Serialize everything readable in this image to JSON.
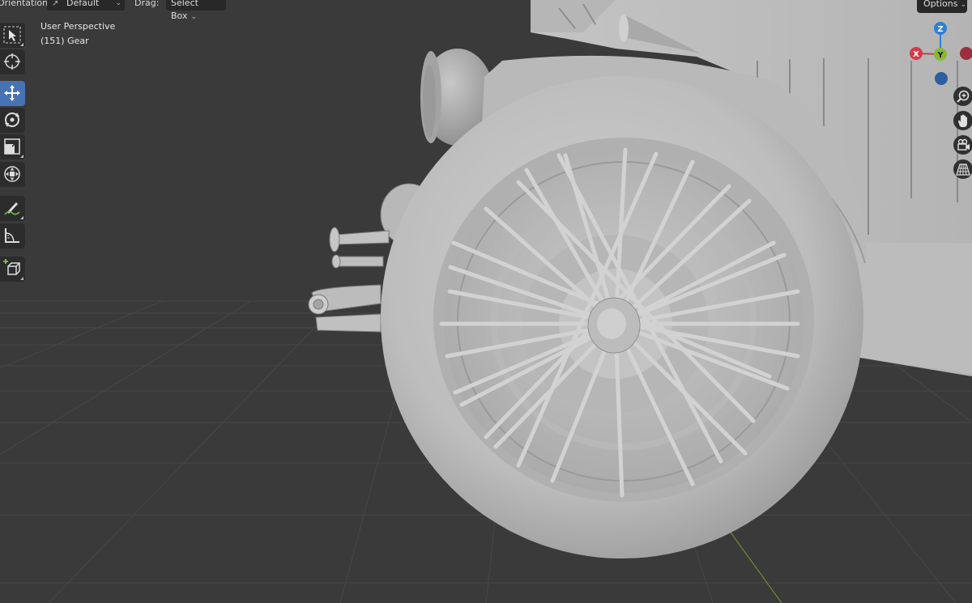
{
  "header": {
    "orientation_label": "Orientation:",
    "orientation_value": "Default",
    "drag_label": "Drag:",
    "drag_value": "Select Box",
    "options_label": "Options"
  },
  "viewport_info": {
    "view_name": "User Perspective",
    "object_info": "(151) Gear"
  },
  "gizmo": {
    "z_label": "Z",
    "x_label": "X",
    "y_label": "Y",
    "colors": {
      "x": "#d43a4a",
      "y": "#8ab833",
      "z": "#2f7fd8",
      "neg_z": "#2d5e9e",
      "neg_x": "#9b2f3b"
    }
  },
  "toolbar": {
    "tools": [
      "select-box",
      "cursor",
      "move",
      "rotate",
      "scale",
      "transform",
      "annotate",
      "measure",
      "add-cube"
    ],
    "active_tool": "move"
  },
  "nav_buttons": [
    "zoom",
    "pan",
    "camera",
    "perspective-grid"
  ],
  "colors": {
    "viewport_bg": "#3a3a3a",
    "active_tool": "#4772b3",
    "model_gray": "#bdbdbd"
  }
}
